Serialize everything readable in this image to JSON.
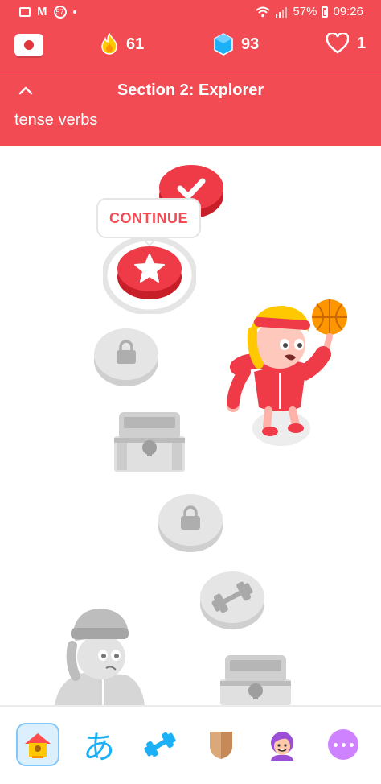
{
  "status_bar": {
    "battery": "57%",
    "time": "09:26",
    "notif_badge": "57"
  },
  "header": {
    "streak": "61",
    "gems": "93",
    "hearts": "1",
    "section_title": "Section 2: Explorer",
    "unit_subtext": "tense verbs"
  },
  "path": {
    "continue_label": "CONTINUE"
  },
  "tabbar": {
    "kana": "あ"
  },
  "colors": {
    "brand_red": "#f34b53",
    "node_red": "#ec3b45",
    "locked_grey": "#e5e5e5",
    "active_tab_bg": "#dbeffd"
  }
}
